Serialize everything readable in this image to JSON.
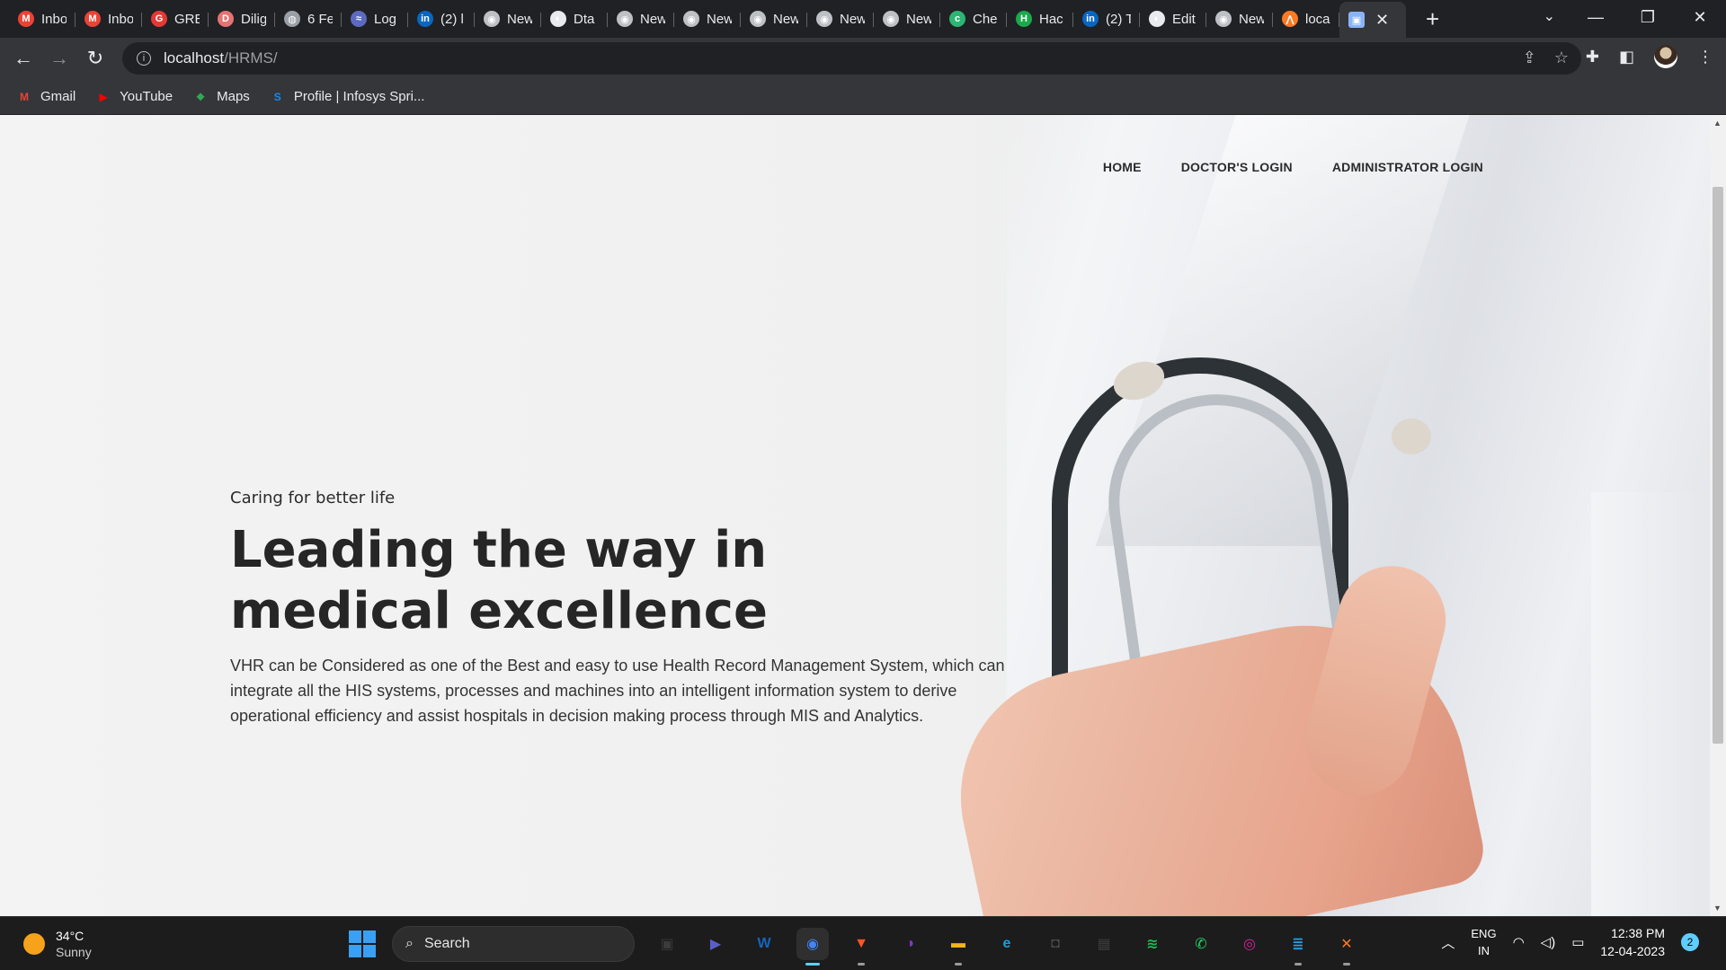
{
  "browser": {
    "tabs": [
      {
        "title": "Inbox",
        "icon": "gmail-icon",
        "color": "#ea4335",
        "glyph": "M"
      },
      {
        "title": "Inbox",
        "icon": "gmail-icon",
        "color": "#ea4335",
        "glyph": "M"
      },
      {
        "title": "GRE",
        "icon": "gre-icon",
        "color": "#e53935",
        "glyph": "G"
      },
      {
        "title": "Dilig",
        "icon": "diligent-icon",
        "color": "#e57373",
        "glyph": "D"
      },
      {
        "title": "6 Fe",
        "icon": "globe-icon",
        "color": "#9aa0a6",
        "glyph": "◍"
      },
      {
        "title": "Log",
        "icon": "logo-swirl-icon",
        "color": "#5c6bc0",
        "glyph": "≈"
      },
      {
        "title": "(2) l",
        "icon": "linkedin-icon",
        "color": "#0a66c2",
        "glyph": "in"
      },
      {
        "title": "New",
        "icon": "chrome-icon",
        "color": "#bdc1c6",
        "glyph": "◉"
      },
      {
        "title": "Dta",
        "icon": "github-icon",
        "color": "#e8eaed",
        "glyph": "◐"
      },
      {
        "title": "New",
        "icon": "chrome-icon",
        "color": "#bdc1c6",
        "glyph": "◉"
      },
      {
        "title": "New",
        "icon": "chrome-icon",
        "color": "#bdc1c6",
        "glyph": "◉"
      },
      {
        "title": "New",
        "icon": "chrome-icon",
        "color": "#bdc1c6",
        "glyph": "◉"
      },
      {
        "title": "New",
        "icon": "chrome-icon",
        "color": "#bdc1c6",
        "glyph": "◉"
      },
      {
        "title": "New",
        "icon": "chrome-icon",
        "color": "#bdc1c6",
        "glyph": "◉"
      },
      {
        "title": "Che",
        "icon": "chegg-icon",
        "color": "#2bb673",
        "glyph": "c"
      },
      {
        "title": "Hac",
        "icon": "hackerrank-icon",
        "color": "#1ba94c",
        "glyph": "H"
      },
      {
        "title": "(2) T",
        "icon": "linkedin-icon",
        "color": "#0a66c2",
        "glyph": "in"
      },
      {
        "title": "Edit",
        "icon": "github-icon",
        "color": "#e8eaed",
        "glyph": "◐"
      },
      {
        "title": "New",
        "icon": "chrome-icon",
        "color": "#bdc1c6",
        "glyph": "◉"
      },
      {
        "title": "loca",
        "icon": "xampp-icon",
        "color": "#fb7a24",
        "glyph": "⋀"
      }
    ],
    "active_tab": {
      "icon": "hrms-favicon-icon",
      "close": "✕"
    },
    "new_tab": "+",
    "address": {
      "host": "localhost",
      "path": "/HRMS/"
    },
    "bookmarks": [
      {
        "label": "Gmail",
        "icon": "gmail-icon",
        "color": "#ea4335",
        "glyph": "M"
      },
      {
        "label": "YouTube",
        "icon": "youtube-icon",
        "color": "#ff0000",
        "glyph": "▶"
      },
      {
        "label": "Maps",
        "icon": "maps-icon",
        "color": "#34a853",
        "glyph": "⬥"
      },
      {
        "label": "Profile | Infosys Spri...",
        "icon": "infosys-icon",
        "color": "#1e88e5",
        "glyph": "S"
      }
    ]
  },
  "site": {
    "nav": [
      "HOME",
      "DOCTOR'S LOGIN",
      "ADMINISTRATOR LOGIN"
    ],
    "tagline": "Caring for better life",
    "headline": "Leading the way in medical excellence",
    "description": "VHR can be Considered as one of the Best and easy to use Health Record Management System, which can integrate all the HIS systems, processes and machines into an intelligent information system to derive operational efficiency and assist hospitals in decision making process through MIS and Analytics."
  },
  "taskbar": {
    "weather": {
      "temp": "34°C",
      "condition": "Sunny"
    },
    "search_placeholder": "Search",
    "apps": [
      {
        "name": "task-view-icon",
        "color": "#3b3b3b",
        "glyph": "▣"
      },
      {
        "name": "teams-chat-icon",
        "color": "#5b5fc7",
        "glyph": "▶"
      },
      {
        "name": "app-w-icon",
        "color": "#1565c0",
        "glyph": "W"
      },
      {
        "name": "chrome-icon",
        "color": "#2f2f2f",
        "glyph": "◉",
        "active": true
      },
      {
        "name": "brave-icon",
        "color": "#fb542b",
        "glyph": "▼",
        "running": true
      },
      {
        "name": "tor-icon",
        "color": "#7e3ac1",
        "glyph": "◑"
      },
      {
        "name": "file-explorer-icon",
        "color": "#f3b41b",
        "glyph": "▬",
        "running": true
      },
      {
        "name": "edge-icon",
        "color": "#1b9de2",
        "glyph": "e"
      },
      {
        "name": "camera-icon",
        "color": "#4a4a4a",
        "glyph": "◘"
      },
      {
        "name": "store-icon",
        "color": "#3a3a3a",
        "glyph": "▦"
      },
      {
        "name": "spotify-icon",
        "color": "#1db954",
        "glyph": "≋"
      },
      {
        "name": "whatsapp-icon",
        "color": "#25d366",
        "glyph": "✆"
      },
      {
        "name": "instagram-icon",
        "color": "#d6249f",
        "glyph": "◎"
      },
      {
        "name": "notepad-icon",
        "color": "#2aa1e6",
        "glyph": "≣",
        "running": true
      },
      {
        "name": "xampp-icon",
        "color": "#fb7a24",
        "glyph": "✕",
        "running": true
      }
    ],
    "tray": {
      "lang1": "ENG",
      "lang2": "IN",
      "time": "12:38 PM",
      "date": "12-04-2023",
      "notifications": "2"
    }
  }
}
